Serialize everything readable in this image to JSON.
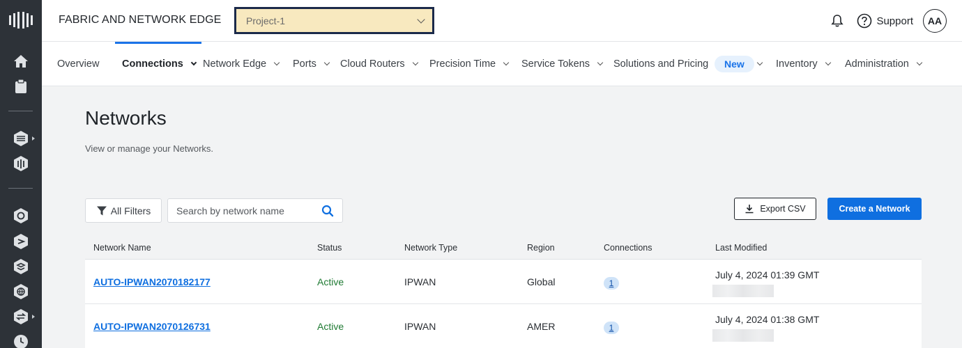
{
  "app": {
    "title": "FABRIC AND NETWORK EDGE"
  },
  "project": {
    "selected": "Project-1"
  },
  "header": {
    "support_label": "Support",
    "avatar_initials": "AA"
  },
  "nav": {
    "items": [
      {
        "label": "Overview",
        "has_menu": false
      },
      {
        "label": "Connections",
        "has_menu": true,
        "active": true
      },
      {
        "label": "Network Edge",
        "has_menu": true
      },
      {
        "label": "Ports",
        "has_menu": true
      },
      {
        "label": "Cloud Routers",
        "has_menu": true
      },
      {
        "label": "Precision Time",
        "has_menu": true
      },
      {
        "label": "Service Tokens",
        "has_menu": true
      },
      {
        "label": "Solutions and Pricing",
        "has_menu": false
      },
      {
        "label": "Inventory",
        "has_menu": true
      },
      {
        "label": "Administration",
        "has_menu": true
      }
    ],
    "new_badge": "New"
  },
  "page": {
    "title": "Networks",
    "subtitle": "View or manage your Networks."
  },
  "toolbar": {
    "filters_label": "All Filters",
    "search_placeholder": "Search by network name",
    "export_label": "Export CSV",
    "create_label": "Create a Network"
  },
  "table": {
    "columns": [
      "Network Name",
      "Status",
      "Network Type",
      "Region",
      "Connections",
      "Last Modified"
    ],
    "rows": [
      {
        "name": "AUTO-IPWAN2070182177",
        "status": "Active",
        "type": "IPWAN",
        "region": "Global",
        "connections": "1",
        "modified": "July 4, 2024 01:39 GMT"
      },
      {
        "name": "AUTO-IPWAN2070126731",
        "status": "Active",
        "type": "IPWAN",
        "region": "AMER",
        "connections": "1",
        "modified": "July 4, 2024 01:38 GMT"
      }
    ]
  },
  "colors": {
    "accent": "#0f6fe0",
    "rail": "#2d3238",
    "project_bg": "#f8e9bf",
    "status_active": "#1f7a33"
  },
  "rail_icons": [
    "equinix-logo-icon",
    "home-icon",
    "clipboard-icon",
    "network-edge-icon",
    "metal-icon",
    "fabric-icon",
    "cloud-router-icon",
    "layers-icon",
    "globe-icon",
    "transfer-icon",
    "clock-icon"
  ]
}
